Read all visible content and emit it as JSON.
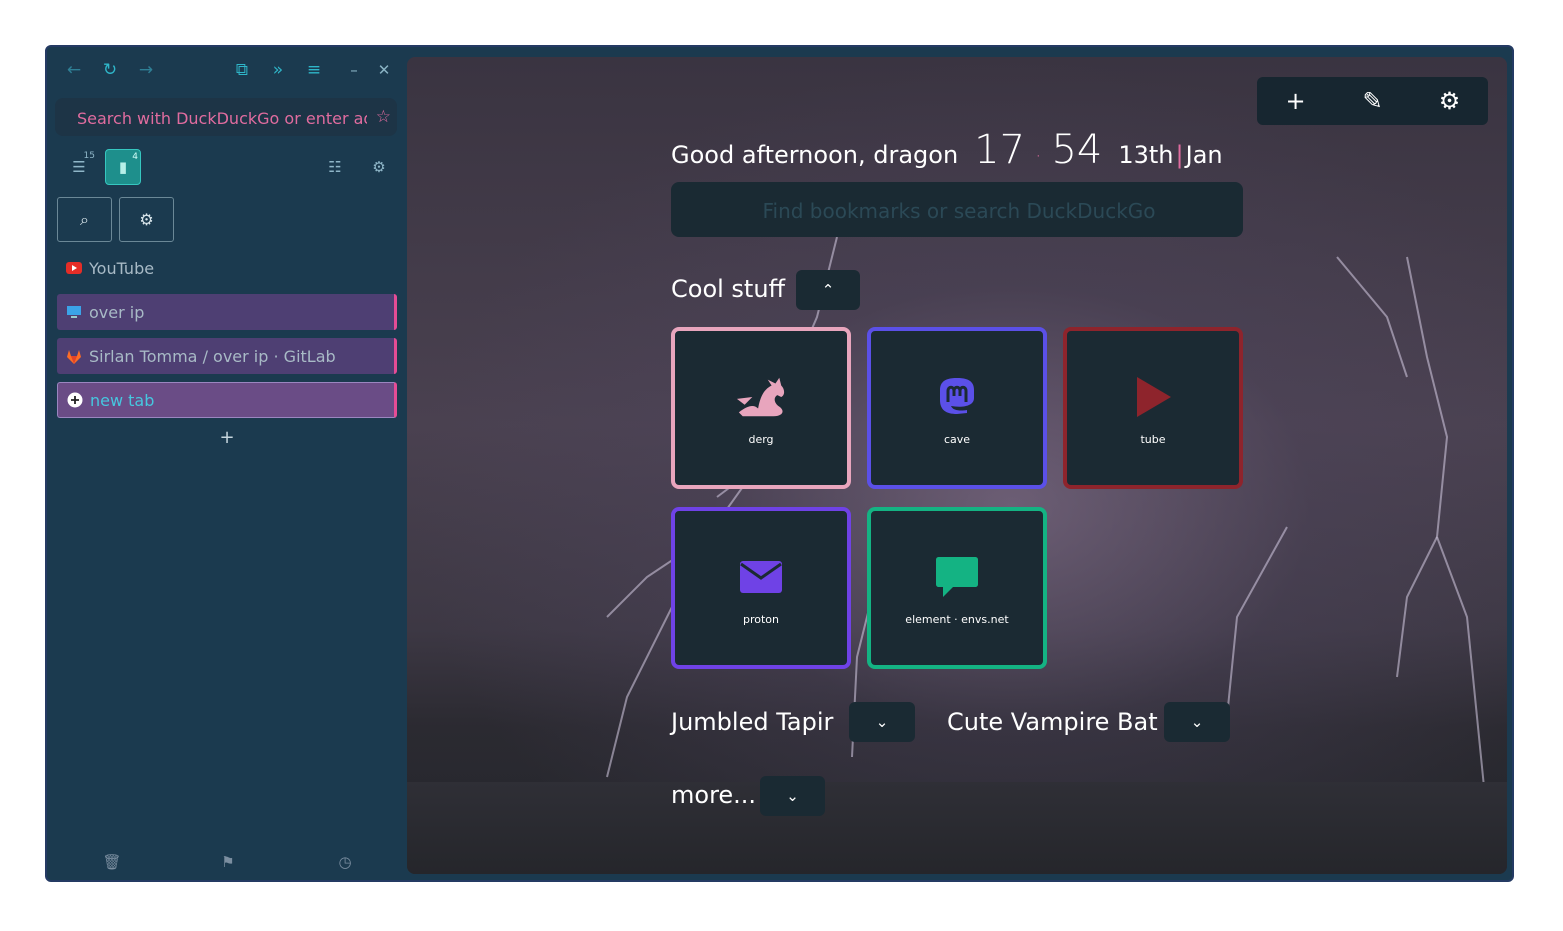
{
  "sidebar": {
    "url_placeholder": "Search with DuckDuckGo or enter address",
    "panel_counts": {
      "tabs": "15",
      "bookmarks": "4"
    },
    "tabs": [
      {
        "title": "YouTube",
        "favicon": "youtube-icon"
      },
      {
        "title": "over ip",
        "favicon": "monitor-icon"
      },
      {
        "title": "Sirlan Tomma / over ip · GitLab",
        "favicon": "gitlab-icon"
      },
      {
        "title": "new tab",
        "favicon": "plus-circle-icon"
      }
    ]
  },
  "page": {
    "greeting": "Good afternoon, dragon",
    "hours": "17",
    "minutes": "54",
    "day": "13th",
    "month": "Jan",
    "search_placeholder": "Find bookmarks or search DuckDuckGo",
    "groups": [
      {
        "title": "Cool stuff",
        "expanded": true,
        "bookmarks": [
          {
            "label": "derg",
            "icon": "dragon-icon",
            "color": "#e8a5bd"
          },
          {
            "label": "cave",
            "icon": "mastodon-icon",
            "color": "#5b50e8"
          },
          {
            "label": "tube",
            "icon": "play-icon",
            "color": "#8e242c"
          },
          {
            "label": "proton",
            "icon": "envelope-icon",
            "color": "#6f42e6"
          },
          {
            "label": "element · envs.net",
            "icon": "chat-icon",
            "color": "#14b383"
          }
        ]
      },
      {
        "title": "Jumbled Tapir",
        "expanded": false
      },
      {
        "title": "Cute Vampire Bat",
        "expanded": false
      },
      {
        "title": "more...",
        "expanded": false
      }
    ]
  },
  "colors": {
    "accent_pink": "#e54c95",
    "accent_teal": "#2fb6c9",
    "sidebar_bg": "#1b3a4f"
  }
}
